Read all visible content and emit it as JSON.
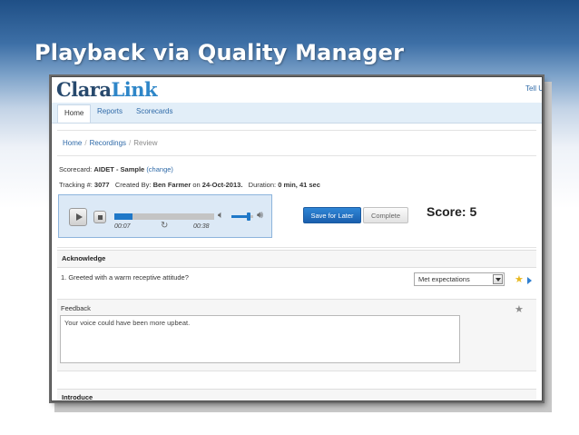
{
  "slide": {
    "title": "Playback via Quality Manager"
  },
  "app": {
    "logo_part1": "Clara",
    "logo_part2": "Link",
    "top_right_link": "Tell Us"
  },
  "nav": {
    "tabs": [
      {
        "label": "Home",
        "active": true
      },
      {
        "label": "Reports"
      },
      {
        "label": "Scorecards"
      }
    ]
  },
  "breadcrumb": {
    "items": [
      "Home",
      "Recordings",
      "Review"
    ],
    "separator": "/"
  },
  "scorecard": {
    "label": "Scorecard:",
    "name": "AIDET - Sample",
    "change_link": "(change)"
  },
  "tracking": {
    "label": "Tracking #:",
    "number": "3077",
    "created_label": "Created By:",
    "created_by": "Ben Farmer",
    "on_label": "on",
    "date": "24-Oct-2013.",
    "duration_label": "Duration:",
    "duration": "0 min, 41 sec"
  },
  "player": {
    "elapsed": "00:07",
    "total": "00:38",
    "progress": 0.18,
    "volume": 0.8
  },
  "actions": {
    "save_later": "Save for Later",
    "complete": "Complete"
  },
  "score": {
    "text": "Score: 5"
  },
  "sections": [
    {
      "title": "Acknowledge",
      "questions": [
        {
          "text": "1. Greeted with a warm receptive attitude?",
          "answer": "Met expectations",
          "starred": true
        }
      ],
      "feedback_label": "Feedback",
      "feedback_text": "Your voice could have been more upbeat."
    },
    {
      "title": "Introduce"
    }
  ],
  "colors": {
    "accent": "#1f78c8",
    "star_active": "#e8b820",
    "star_inactive": "#8c8c8c",
    "link": "#2f6aa8"
  },
  "icons": [
    "play-icon",
    "stop-icon",
    "replay-icon",
    "volume-low-icon",
    "volume-high-icon",
    "star-icon",
    "chevron-down-icon",
    "arrow-right-icon"
  ]
}
